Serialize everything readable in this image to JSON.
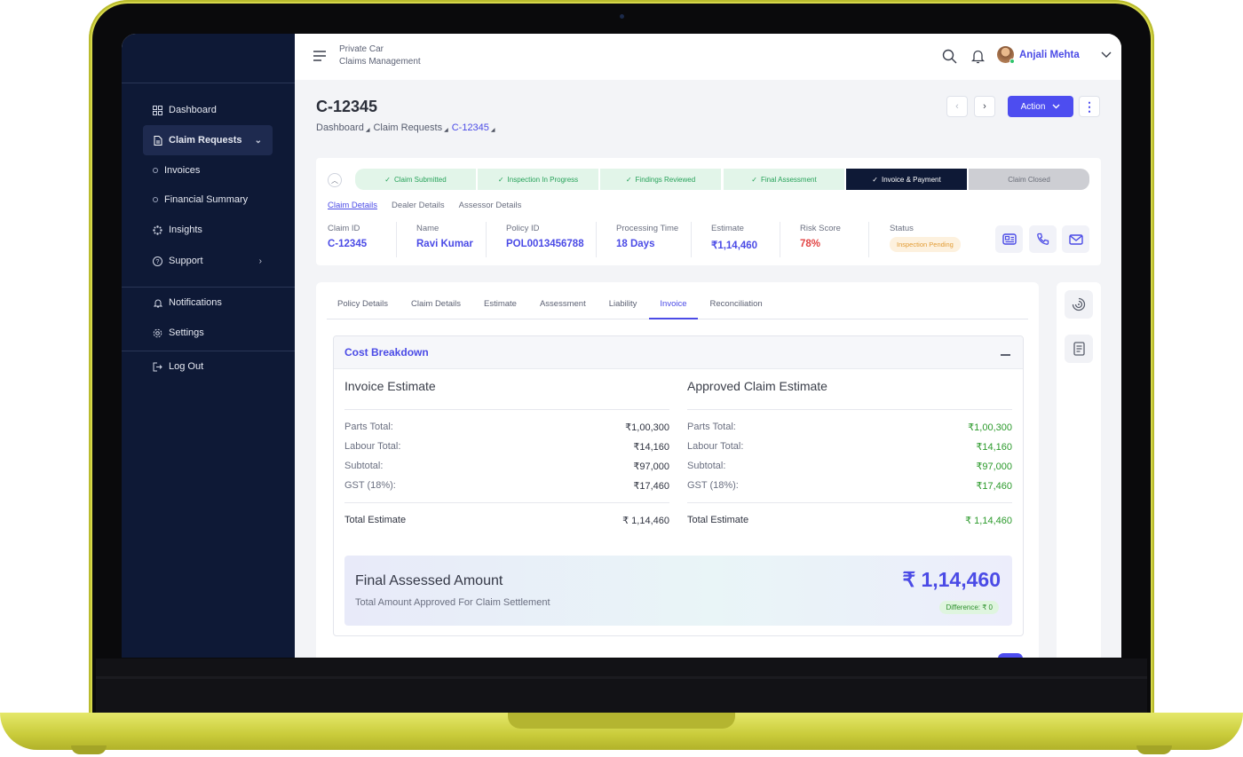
{
  "app": {
    "brand_line1": "Private Car",
    "brand_line2": "Claims Management"
  },
  "user": {
    "name": "Anjali Mehta"
  },
  "sidebar": {
    "items": [
      {
        "label": "Dashboard"
      },
      {
        "label": "Claim Requests"
      },
      {
        "label": "Invoices"
      },
      {
        "label": "Financial Summary"
      },
      {
        "label": "Insights"
      },
      {
        "label": "Support"
      },
      {
        "label": "Notifications"
      },
      {
        "label": "Settings"
      },
      {
        "label": "Log Out"
      }
    ]
  },
  "page": {
    "title": "C-12345",
    "breadcrumb": [
      "Dashboard",
      "Claim Requests",
      "C-12345"
    ],
    "action_label": "Action"
  },
  "steps": [
    {
      "label": "Claim Submitted",
      "state": "done"
    },
    {
      "label": "Inspection In Progress",
      "state": "done"
    },
    {
      "label": "Findings Reviewed",
      "state": "done"
    },
    {
      "label": "Final Assessment",
      "state": "done"
    },
    {
      "label": "Invoice & Payment",
      "state": "current"
    },
    {
      "label": "Claim Closed",
      "state": "pending"
    }
  ],
  "subtabs": [
    "Claim Details",
    "Dealer Details",
    "Assessor Details"
  ],
  "claim_info": [
    {
      "label": "Claim ID",
      "value": "C-12345"
    },
    {
      "label": "Name",
      "value": "Ravi Kumar"
    },
    {
      "label": "Policy ID",
      "value": "POL0013456788"
    },
    {
      "label": "Processing Time",
      "value": "18 Days"
    },
    {
      "label": "Estimate",
      "value": "₹1,14,460"
    },
    {
      "label": "Risk Score",
      "value": "78%"
    },
    {
      "label": "Status",
      "value": "Inspection Pending"
    }
  ],
  "tabs": [
    "Policy Details",
    "Claim Details",
    "Estimate",
    "Assessment",
    "Liability",
    "Invoice",
    "Reconciliation"
  ],
  "active_tab": "Invoice",
  "cost_breakdown": {
    "title": "Cost Breakdown",
    "invoice": {
      "heading": "Invoice Estimate",
      "rows": [
        {
          "label": "Parts Total:",
          "value": "₹1,00,300"
        },
        {
          "label": "Labour Total:",
          "value": "₹14,160"
        },
        {
          "label": "Subtotal:",
          "value": "₹97,000"
        },
        {
          "label": "GST (18%):",
          "value": "₹17,460"
        }
      ],
      "total_label": "Total Estimate",
      "total_value": "₹ 1,14,460"
    },
    "approved": {
      "heading": "Approved Claim Estimate",
      "rows": [
        {
          "label": "Parts Total:",
          "value": "₹1,00,300"
        },
        {
          "label": "Labour Total:",
          "value": "₹14,160"
        },
        {
          "label": "Subtotal:",
          "value": "₹97,000"
        },
        {
          "label": "GST (18%):",
          "value": "₹17,460"
        }
      ],
      "total_label": "Total Estimate",
      "total_value": "₹ 1,14,460"
    },
    "final": {
      "title": "Final Assessed Amount",
      "subtitle": "Total Amount Approved For Claim Settlement",
      "amount": "₹ 1,14,460",
      "difference": "Difference: ₹ 0"
    }
  },
  "colors": {
    "accent": "#4b4be6",
    "sidebar": "#0e1936",
    "success": "#2b9a2b",
    "danger": "#e24545",
    "bezel": "#d6d84a"
  }
}
